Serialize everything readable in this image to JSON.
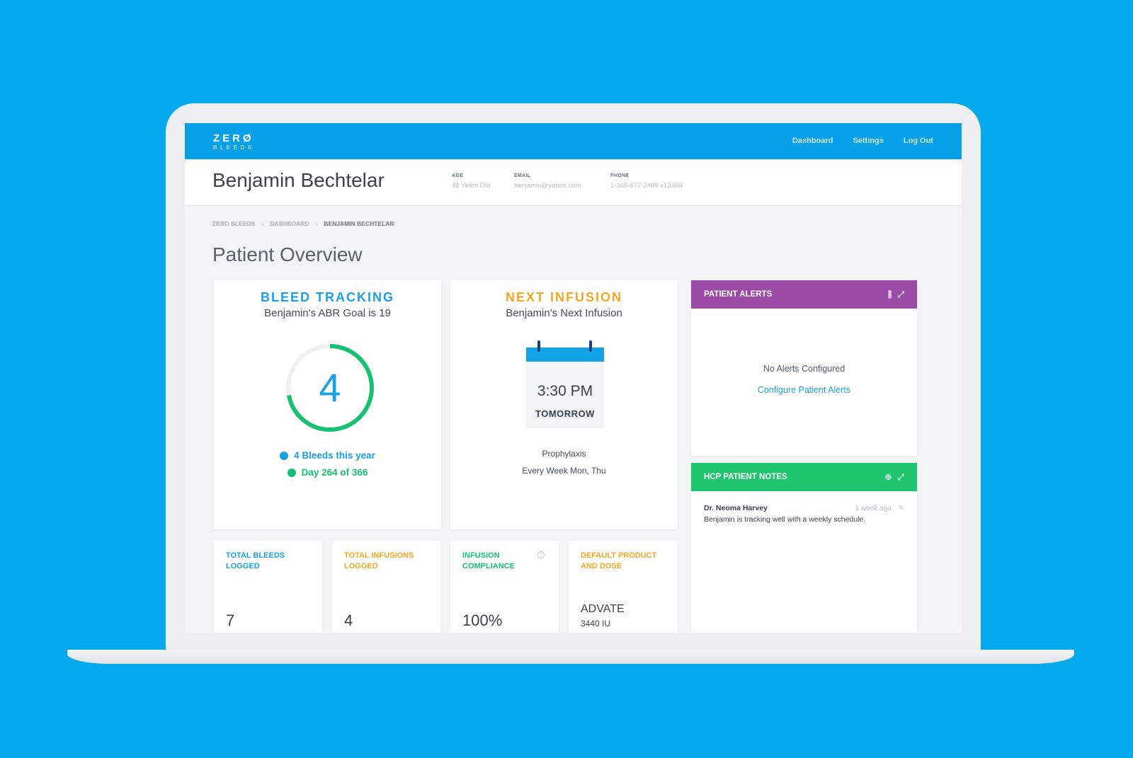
{
  "brand": {
    "logo_main": "ZERØ",
    "logo_sub": "BLEEDS"
  },
  "nav": {
    "items": [
      "Dashboard",
      "Settings",
      "Log Out"
    ]
  },
  "patient": {
    "name": "Benjamin Bechtelar",
    "age_label": "AGE",
    "age_value": "48 Years Old",
    "email_label": "EMAIL",
    "email_value": "benjamin@yahoo.com",
    "phone_label": "PHONE",
    "phone_value": "1-345-677-2469 x12466"
  },
  "breadcrumb": {
    "items": [
      "ZERO BLEEDS",
      "DASHBOARD",
      "BENJAMIN BECHTELAR"
    ],
    "separator": "›"
  },
  "page_title": "Patient Overview",
  "bleed_tracking": {
    "title": "BLEED TRACKING",
    "subtitle": "Benjamin's ABR Goal is 19",
    "count": "4",
    "legend_bleeds": "4 Bleeds this year",
    "legend_day": "Day 264 of 366",
    "day_current": 264,
    "day_total": 366,
    "colors": {
      "blue": "#1aa0e5",
      "green": "#16c172"
    }
  },
  "next_infusion": {
    "title": "NEXT INFUSION",
    "subtitle": "Benjamin's Next Infusion",
    "time": "3:30 PM",
    "day": "TOMORROW",
    "type": "Prophylaxis",
    "schedule": "Every Week Mon, Thu",
    "color": "#f5a623"
  },
  "patient_alerts": {
    "title": "PATIENT ALERTS",
    "empty_text": "No Alerts Configured",
    "configure_link": "Configure Patient Alerts",
    "color": "#9b4aa5",
    "icons": [
      "sliders-icon",
      "expand-icon"
    ]
  },
  "hcp_notes": {
    "title": "HCP PATIENT NOTES",
    "color": "#1fc46f",
    "icons": [
      "add-icon",
      "expand-icon"
    ],
    "note": {
      "author": "Dr. Neoma Harvey",
      "time": "1 week ago",
      "text": "Benjamin is tracking well with a weekly schedule."
    }
  },
  "stats": [
    {
      "label": "TOTAL BLEEDS LOGGED",
      "value": "7",
      "sub": "",
      "color": "#1aa0e5"
    },
    {
      "label": "TOTAL INFUSIONS LOGGED",
      "value": "4",
      "sub": "",
      "color": "#f5a623"
    },
    {
      "label": "INFUSION COMPLIANCE",
      "value": "100%",
      "sub": "",
      "color": "#16c172"
    },
    {
      "label": "DEFAULT PRODUCT AND DOSE",
      "value": "ADVATE",
      "sub": "3440 IU",
      "color": "#f5a623"
    }
  ]
}
